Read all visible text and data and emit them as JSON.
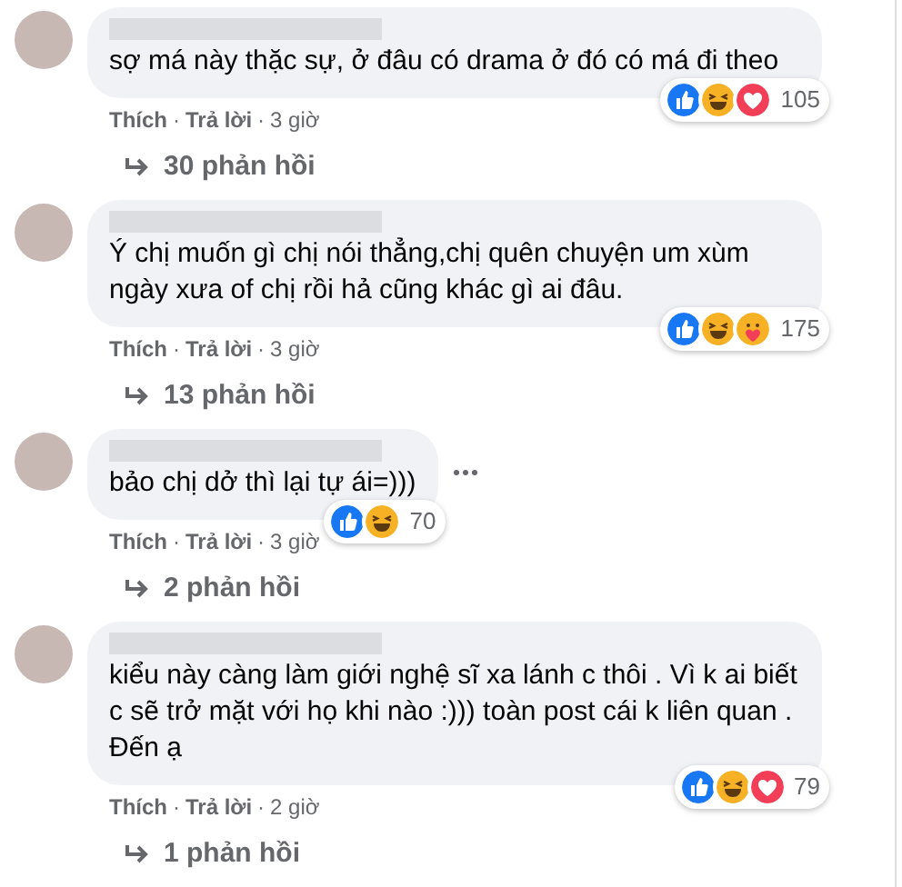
{
  "comments": [
    {
      "text": "sợ má này thặc sự, ở đâu có drama ở đó có má đi theo",
      "more_menu": false,
      "reactions": [
        {
          "kind": "like"
        },
        {
          "kind": "haha"
        },
        {
          "kind": "love"
        }
      ],
      "reaction_count": "105",
      "actions": [
        "Thích",
        "Trả lời"
      ],
      "separator": "·",
      "time": "3 giờ",
      "replies": "30 phản hồi"
    },
    {
      "text": "Ý chị muốn gì chị nói thẳng,chị quên chuyện um xùm ngày xưa of chị rồi hả cũng khác gì ai đâu.",
      "more_menu": false,
      "reactions": [
        {
          "kind": "like"
        },
        {
          "kind": "haha"
        },
        {
          "kind": "care"
        }
      ],
      "reaction_count": "175",
      "actions": [
        "Thích",
        "Trả lời"
      ],
      "separator": "·",
      "time": "3 giờ",
      "replies": "13 phản hồi"
    },
    {
      "text": "bảo chị dở thì lại tự ái=)))",
      "more_menu": true,
      "reactions": [
        {
          "kind": "like"
        },
        {
          "kind": "haha"
        }
      ],
      "reaction_count": "70",
      "actions": [
        "Thích",
        "Trả lời"
      ],
      "separator": "·",
      "time": "3 giờ",
      "replies": "2 phản hồi"
    },
    {
      "text": "kiểu này càng làm giới nghệ sĩ xa lánh c thôi . Vì k ai biết c sẽ trở mặt với họ khi nào :))) toàn post cái k liên quan . Đến ạ",
      "more_menu": false,
      "reactions": [
        {
          "kind": "like"
        },
        {
          "kind": "haha"
        },
        {
          "kind": "love"
        }
      ],
      "reaction_count": "79",
      "actions": [
        "Thích",
        "Trả lời"
      ],
      "separator": "·",
      "time": "2 giờ",
      "replies": "1 phản hồi"
    }
  ]
}
